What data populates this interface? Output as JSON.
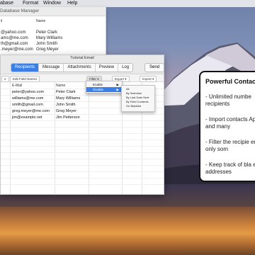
{
  "menubar": {
    "items": [
      "abase",
      "Format",
      "Window",
      "Help"
    ]
  },
  "back_window": {
    "title": "Database Manager",
    "columns": [
      "il",
      "Name"
    ],
    "rows": [
      {
        "email": "@yahoo.com",
        "name": "Peter Clark"
      },
      {
        "email": "ams@me.com",
        "name": "Mary Williams"
      },
      {
        "email": "th@gmail.com",
        "name": "John Smith"
      },
      {
        "email": ".meyer@me.com",
        "name": "Greg Meyer"
      }
    ]
  },
  "email_window": {
    "title": "Tutorial Email",
    "tabs": [
      {
        "label": "Recipients",
        "active": true
      },
      {
        "label": "Message",
        "active": false
      },
      {
        "label": "Attachments",
        "active": false
      },
      {
        "label": "Preview",
        "active": false
      },
      {
        "label": "Log",
        "active": false
      }
    ],
    "send_label": "Send",
    "subbar": {
      "left_btn": "e",
      "edit_fields": "Edit Field Names",
      "filter": "Filter",
      "export": "Export",
      "import": "Import"
    },
    "table": {
      "headers": [
        "E-Mail",
        "Name"
      ],
      "rows": [
        {
          "email": "peter@yahoo.com",
          "name": "Peter Clark"
        },
        {
          "email": "williams@me.com",
          "name": "Mary Williams"
        },
        {
          "email": "smith@gmail.com",
          "name": "John Smith"
        },
        {
          "email": "greg.meyer@me.com",
          "name": "Greg Meyer"
        },
        {
          "email": "jim@example.net",
          "name": "Jim Petterson"
        }
      ]
    }
  },
  "filter_menu": {
    "items": [
      {
        "label": "Enable",
        "selected": false
      },
      {
        "label": "Disable",
        "selected": true
      }
    ],
    "submenu": [
      "All",
      "By Selection",
      "By Last Date Sent",
      "By Field Contents",
      "On Blacklist"
    ]
  },
  "panel": {
    "title": "Powerful Contac",
    "bullets": [
      "- Unlimited numbe recipients",
      "- Import contacts Apps and many",
      "- Filter the recipie enable only som",
      "- Keep track of bla email addresses"
    ]
  },
  "colors": {
    "accent": "#3a7ee6"
  }
}
